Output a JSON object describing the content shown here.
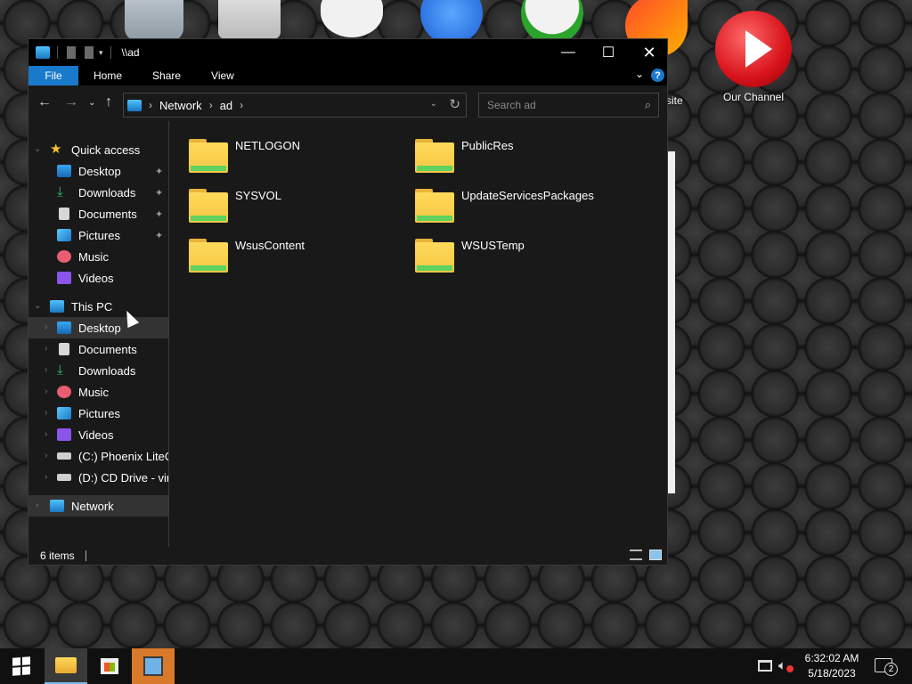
{
  "desktop": {
    "icons": [
      {
        "name": "Recycle Bin",
        "label": ""
      },
      {
        "name": "Folder",
        "label": ""
      },
      {
        "name": "Game Controller",
        "label": ""
      },
      {
        "name": "Blue App",
        "label": ""
      },
      {
        "name": "Xbox",
        "label": ""
      },
      {
        "name": "Website",
        "label": "site"
      },
      {
        "name": "Our Channel",
        "label": "Our Channel"
      }
    ]
  },
  "window": {
    "title": "\\\\ad",
    "controls": {
      "minimize": "—",
      "maximize": "☐",
      "close": "✕"
    }
  },
  "ribbon": {
    "tabs": [
      "File",
      "Home",
      "Share",
      "View"
    ],
    "expand": "⌄",
    "help": "?"
  },
  "navigation": {
    "back": "←",
    "forward": "→",
    "recent": "⌄",
    "up": "↑",
    "breadcrumb": [
      "Network",
      "ad"
    ],
    "dropdown": "⌄",
    "refresh": "↻",
    "search_placeholder": "Search ad"
  },
  "nav_pane": {
    "quick_access": {
      "label": "Quick access",
      "items": [
        {
          "label": "Desktop",
          "icon": "desktop-icon",
          "pinned": true
        },
        {
          "label": "Downloads",
          "icon": "download-icon",
          "pinned": true
        },
        {
          "label": "Documents",
          "icon": "documents-icon",
          "pinned": true
        },
        {
          "label": "Pictures",
          "icon": "pictures-icon",
          "pinned": true
        },
        {
          "label": "Music",
          "icon": "music-icon",
          "pinned": false
        },
        {
          "label": "Videos",
          "icon": "videos-icon",
          "pinned": false
        }
      ]
    },
    "this_pc": {
      "label": "This PC",
      "items": [
        {
          "label": "Desktop",
          "icon": "desktop-icon",
          "selected": true
        },
        {
          "label": "Documents",
          "icon": "documents-icon"
        },
        {
          "label": "Downloads",
          "icon": "download-icon"
        },
        {
          "label": "Music",
          "icon": "music-icon"
        },
        {
          "label": "Pictures",
          "icon": "pictures-icon"
        },
        {
          "label": "Videos",
          "icon": "videos-icon"
        },
        {
          "label": "(C:) Phoenix LiteO",
          "icon": "drive-icon"
        },
        {
          "label": "(D:) CD Drive - virt",
          "icon": "cd-drive-icon"
        }
      ]
    },
    "network": {
      "label": "Network",
      "icon": "network-icon"
    }
  },
  "content": {
    "folders": [
      "NETLOGON",
      "PublicRes",
      "SYSVOL",
      "UpdateServicesPackages",
      "WsusContent",
      "WSUSTemp"
    ]
  },
  "status": {
    "item_count": "6 items"
  },
  "taskbar": {
    "apps": [
      "File Explorer",
      "Microsoft Store",
      "Tool"
    ],
    "time": "6:32:02 AM",
    "date": "5/18/2023",
    "notification_count": "2"
  },
  "colors": {
    "accent": "#1979ca",
    "folder": "#f6c744",
    "window_bg": "#191919",
    "taskbar": "#101010"
  }
}
